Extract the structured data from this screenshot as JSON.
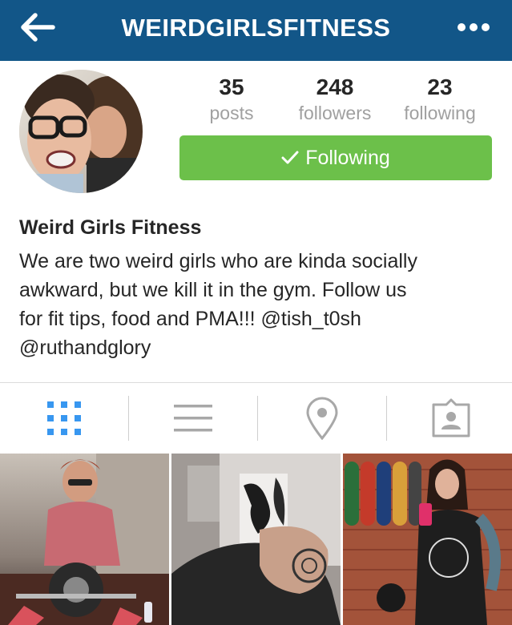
{
  "header": {
    "title": "WEIRDGIRLSFITNESS",
    "bar_color": "#125688",
    "back_icon": "arrow-left-icon",
    "more_icon": "more-dots-icon"
  },
  "profile": {
    "stats": [
      {
        "value": "35",
        "label": "posts"
      },
      {
        "value": "248",
        "label": "followers"
      },
      {
        "value": "23",
        "label": "following"
      }
    ],
    "follow_button": {
      "label": "Following",
      "color": "#6cc04a",
      "icon": "checkmark-icon"
    },
    "name": "Weird Girls Fitness",
    "bio_lines": [
      "We are two weird girls who are kinda socially",
      "awkward, but we kill it in the gym. Follow us",
      "for fit tips, food and PMA!!! @tish_t0sh",
      "@ruthandglory"
    ]
  },
  "tabs": [
    {
      "name": "grid-view",
      "icon": "grid-icon",
      "active": true,
      "color": "#3897f0"
    },
    {
      "name": "list-view",
      "icon": "list-icon",
      "active": false
    },
    {
      "name": "map-view",
      "icon": "location-pin-icon",
      "active": false
    },
    {
      "name": "tagged-view",
      "icon": "tagged-photos-icon",
      "active": false
    }
  ],
  "posts": [
    "post-photo-1",
    "post-photo-2",
    "post-photo-3"
  ]
}
